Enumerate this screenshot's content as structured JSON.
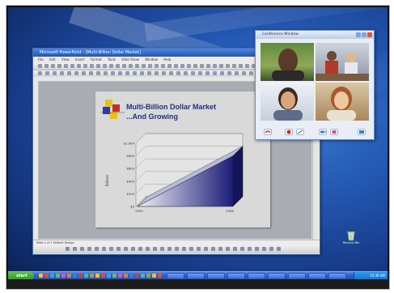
{
  "ppt": {
    "title": "Microsoft PowerPoint - [Multi-Billion Dollar Market]",
    "menu": [
      "File",
      "Edit",
      "View",
      "Insert",
      "Format",
      "Tools",
      "Slide Show",
      "Window",
      "Help"
    ],
    "status": "Slide 1 of 1   Default Design"
  },
  "slide": {
    "title_line1": "Multi-Billion Dollar Market",
    "title_line2": "...And Growing"
  },
  "chart_data": {
    "type": "area",
    "categories": [
      "2005",
      "2008"
    ],
    "values": [
      0,
      800
    ],
    "ylabel": "Billions",
    "ylim": [
      0,
      1000
    ],
    "yticks": [
      "$1,000",
      "$800",
      "$600",
      "$400",
      "$200",
      "$0"
    ],
    "colors": {
      "fill_start": "#f0f0f6",
      "fill_end": "#1c1c78"
    }
  },
  "video": {
    "title": "Conference Window"
  },
  "taskbar": {
    "start_label": "start",
    "clock": "10:30 AM"
  },
  "desktop": {
    "recycle_label": "Recycle Bin"
  },
  "colors": {
    "accent": "#2356b3",
    "slide_title": "#22307a",
    "record": "#e02020"
  }
}
